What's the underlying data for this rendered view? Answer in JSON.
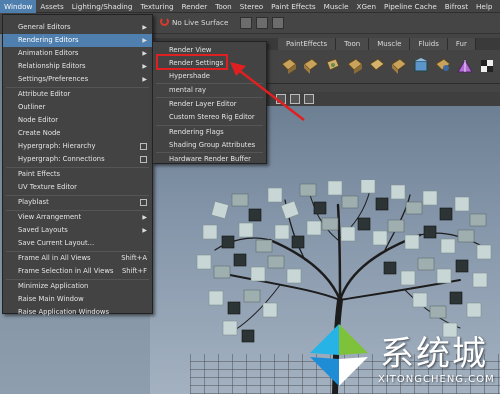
{
  "menubar": [
    "Window",
    "Assets",
    "Lighting/Shading",
    "Texturing",
    "Render",
    "Toon",
    "Stereo",
    "Paint Effects",
    "Muscle",
    "XGen",
    "Pipeline Cache",
    "Bifrost",
    "Help"
  ],
  "toolbar": {
    "live_surface": "No Live Surface"
  },
  "shelf_tabs": [
    "PaintEffects",
    "Toon",
    "Muscle",
    "Fluids",
    "Fur"
  ],
  "window_menu": [
    {
      "label": "General Editors",
      "arrow": "▶"
    },
    {
      "label": "Rendering Editors",
      "arrow": "▶"
    },
    {
      "label": "Animation Editors",
      "arrow": "▶"
    },
    {
      "label": "Relationship Editors",
      "arrow": "▶"
    },
    {
      "label": "Settings/Preferences",
      "arrow": "▶"
    },
    {
      "label": "Attribute Editor"
    },
    {
      "label": "Outliner"
    },
    {
      "label": "Node Editor"
    },
    {
      "label": "Create Node"
    },
    {
      "label": "Hypergraph: Hierarchy"
    },
    {
      "label": "Hypergraph: Connections"
    },
    {
      "label": "Paint Effects"
    },
    {
      "label": "UV Texture Editor"
    },
    {
      "label": "Playblast"
    },
    {
      "label": "View Arrangement",
      "arrow": "▶"
    },
    {
      "label": "Saved Layouts",
      "arrow": "▶"
    },
    {
      "label": "Save Current Layout..."
    },
    {
      "label": "Frame All in All Views",
      "shortcut": "Shift+A"
    },
    {
      "label": "Frame Selection in All Views",
      "shortcut": "Shift+F"
    },
    {
      "label": "Minimize Application"
    },
    {
      "label": "Raise Main Window"
    },
    {
      "label": "Raise Application Windows"
    }
  ],
  "rendering_submenu": [
    "Render View",
    "Render Settings",
    "Hypershade",
    "mental ray",
    "Render Layer Editor",
    "Custom Stereo Rig Editor",
    "Rendering Flags",
    "Shading Group Attributes",
    "Hardware Render Buffer"
  ],
  "watermark": {
    "text": "系统城",
    "url": "XITONGCHENG.COM"
  },
  "colors": {
    "highlight": "#4f7fae",
    "callout": "#e02020"
  }
}
